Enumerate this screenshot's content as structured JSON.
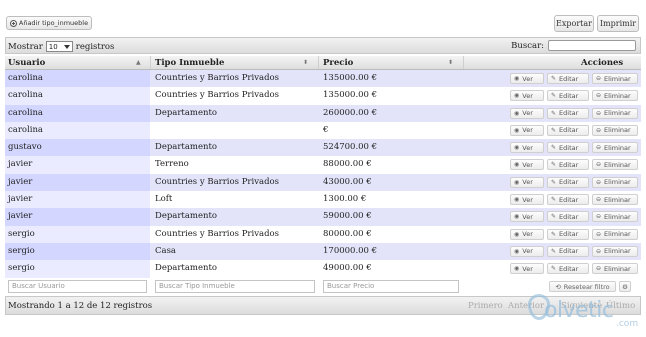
{
  "toolbar": {
    "add_label": "Añadir tipo_inmueble",
    "export_label": "Exportar",
    "print_label": "Imprimir"
  },
  "length": {
    "prefix": "Mostrar",
    "value": "10",
    "suffix": "registros"
  },
  "search": {
    "label": "Buscar:"
  },
  "columns": [
    "Usuario",
    "Tipo Inmueble",
    "Precio",
    "Acciones"
  ],
  "rows": [
    {
      "usuario": "carolina",
      "tipo": "Countries y Barrios Privados",
      "precio": "135000.00 €"
    },
    {
      "usuario": "carolina",
      "tipo": "Countries y Barrios Privados",
      "precio": "135000.00 €"
    },
    {
      "usuario": "carolina",
      "tipo": "Departamento",
      "precio": "260000.00 €"
    },
    {
      "usuario": "carolina",
      "tipo": "",
      "precio": "€"
    },
    {
      "usuario": "gustavo",
      "tipo": "Departamento",
      "precio": "524700.00 €"
    },
    {
      "usuario": "javier",
      "tipo": "Terreno",
      "precio": "88000.00 €"
    },
    {
      "usuario": "javier",
      "tipo": "Countries y Barrios Privados",
      "precio": "43000.00 €"
    },
    {
      "usuario": "javier",
      "tipo": "Loft",
      "precio": "1300.00 €"
    },
    {
      "usuario": "javier",
      "tipo": "Departamento",
      "precio": "59000.00 €"
    },
    {
      "usuario": "sergio",
      "tipo": "Countries y Barrios Privados",
      "precio": "80000.00 €"
    },
    {
      "usuario": "sergio",
      "tipo": "Casa",
      "precio": "170000.00 €"
    },
    {
      "usuario": "sergio",
      "tipo": "Departamento",
      "precio": "49000.00 €"
    }
  ],
  "actions": {
    "view": "Ver",
    "edit": "Editar",
    "delete": "Eliminar"
  },
  "filters": {
    "usuario": "Buscar Usuario",
    "tipo": "Buscar Tipo Inmueble",
    "precio": "Buscar Precio",
    "reset": "Resetear filtro"
  },
  "footer": {
    "info": "Mostrando 1 a 12 de 12 registros",
    "first": "Primero",
    "prev": "Anterior",
    "next": "Siguiente",
    "last": "Último"
  },
  "watermark": {
    "word": "olvetic",
    "suffix": ".com"
  }
}
